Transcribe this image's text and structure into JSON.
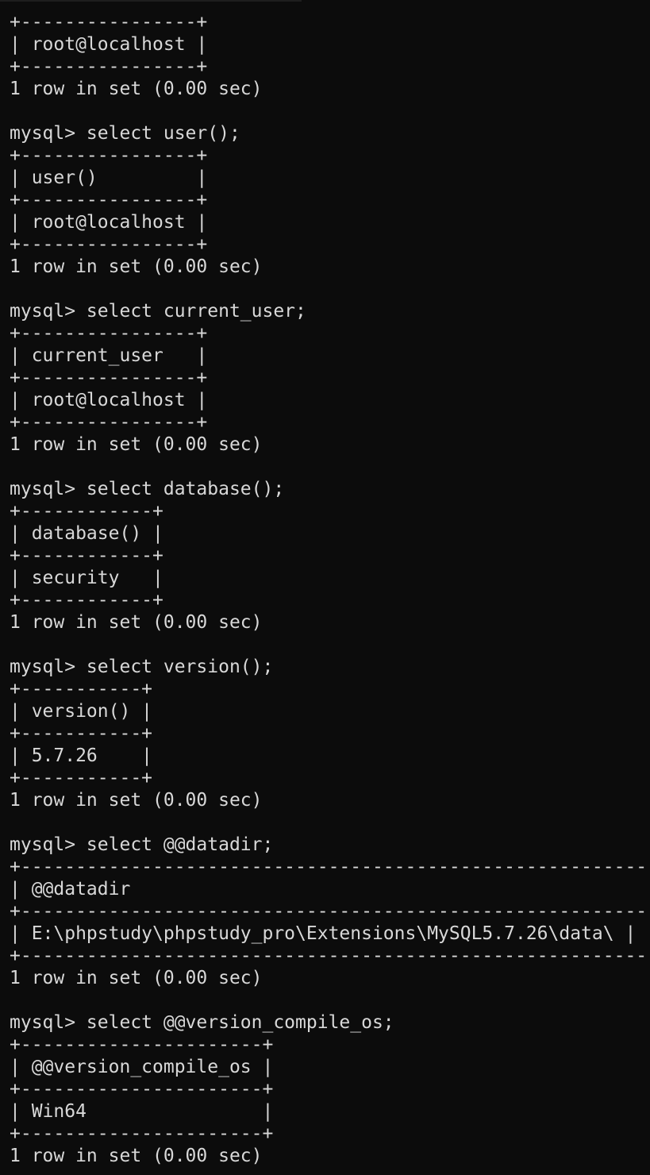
{
  "terminal": {
    "lines": [
      "+----------------+",
      "| root@localhost |",
      "+----------------+",
      "1 row in set (0.00 sec)",
      "",
      "mysql> select user();",
      "+----------------+",
      "| user()         |",
      "+----------------+",
      "| root@localhost |",
      "+----------------+",
      "1 row in set (0.00 sec)",
      "",
      "mysql> select current_user;",
      "+----------------+",
      "| current_user   |",
      "+----------------+",
      "| root@localhost |",
      "+----------------+",
      "1 row in set (0.00 sec)",
      "",
      "mysql> select database();",
      "+------------+",
      "| database() |",
      "+------------+",
      "| security   |",
      "+------------+",
      "1 row in set (0.00 sec)",
      "",
      "mysql> select version();",
      "+-----------+",
      "| version() |",
      "+-----------+",
      "| 5.7.26    |",
      "+-----------+",
      "1 row in set (0.00 sec)",
      "",
      "mysql> select @@datadir;",
      "+-----------------------------------------------------------+",
      "| @@datadir                                                 |",
      "+-----------------------------------------------------------+",
      "| E:\\phpstudy\\phpstudy_pro\\Extensions\\MySQL5.7.26\\data\\ |",
      "+-----------------------------------------------------------+",
      "1 row in set (0.00 sec)",
      "",
      "mysql> select @@version_compile_os;",
      "+----------------------+",
      "| @@version_compile_os |",
      "+----------------------+",
      "| Win64                |",
      "+----------------------+",
      "1 row in set (0.00 sec)"
    ]
  }
}
